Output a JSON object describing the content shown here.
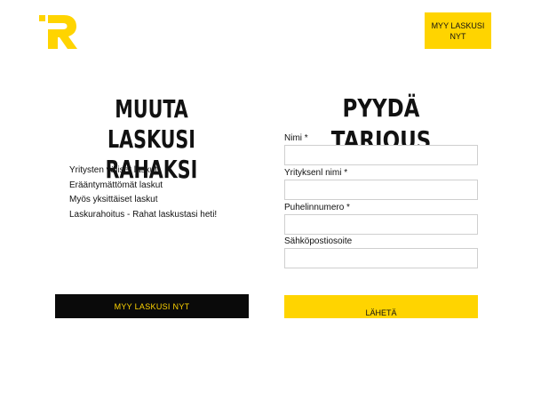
{
  "header": {
    "logo_icon": "logo-r-icon",
    "brand_color": "#ffd400",
    "cta_label": "MYY LASKUSI NYT"
  },
  "hero": {
    "title": "MUUTA LASKUSI RAHAKSI",
    "benefits": [
      "Yritysten väliset laskut",
      "Erääntymättömät laskut",
      "Myös yksittäiset laskut",
      "Laskurahoitus - Rahat laskustasi heti!"
    ],
    "cta_label": "MYY LASKUSI NYT",
    "cta_bg": "#0a0a0a",
    "cta_color": "#ffd400"
  },
  "form": {
    "title": "PYYDÄ TARJOUS",
    "fields": [
      {
        "label": "Nimi *",
        "value": ""
      },
      {
        "label": "Yrityksenl nimi *",
        "value": ""
      },
      {
        "label": "Puhelinnumero *",
        "value": ""
      },
      {
        "label": "Sähköpostiosoite",
        "value": ""
      }
    ],
    "submit_label": "LÄHETÄ"
  }
}
